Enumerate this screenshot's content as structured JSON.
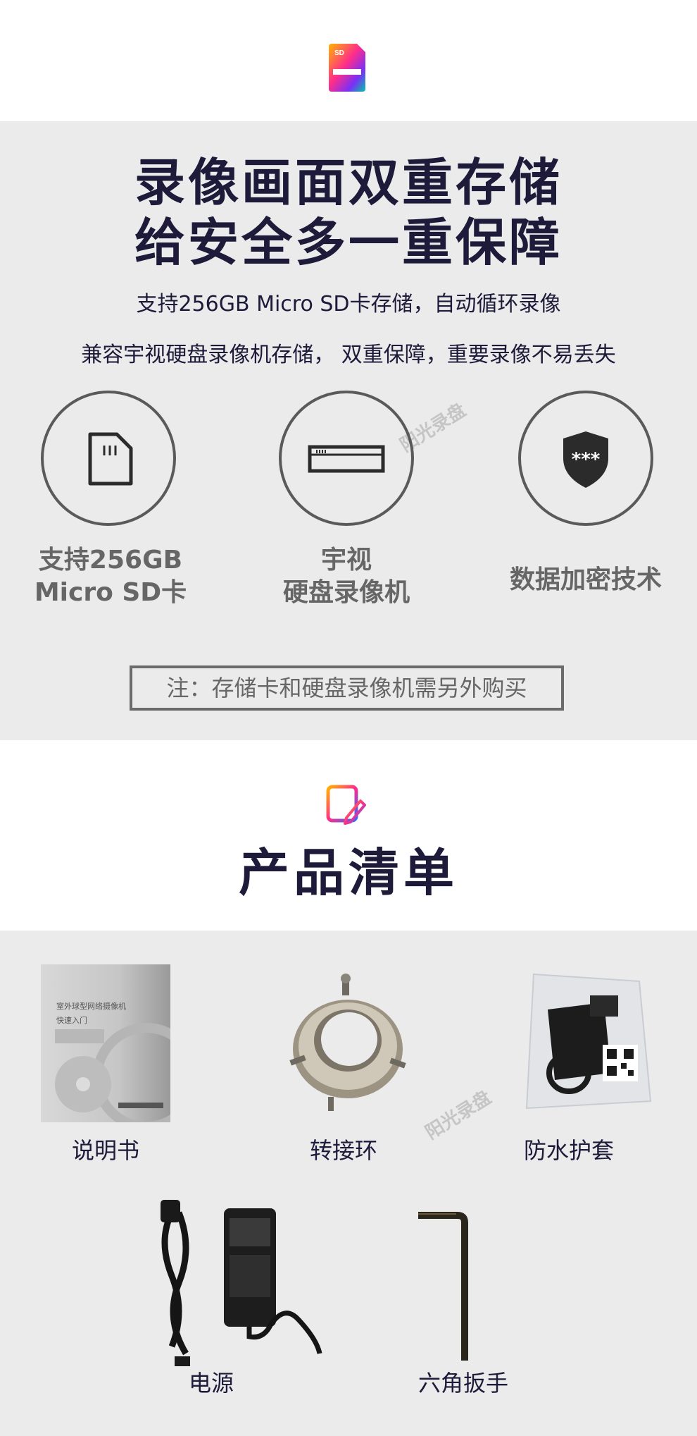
{
  "storage": {
    "title_line1": "录像画面双重存储",
    "title_line2": "给安全多一重保障",
    "subtitle1": "支持256GB Micro SD卡存储，自动循环录像",
    "subtitle2": "兼容宇视硬盘录像机存储， 双重保障，重要录像不易丢失",
    "features": [
      {
        "line1": "支持256GB",
        "line2": "Micro SD卡",
        "icon": "sd-card-icon"
      },
      {
        "line1": "宇视",
        "line2": "硬盘录像机",
        "icon": "nvr-icon"
      },
      {
        "line1": "数据加密技术",
        "icon": "shield-password-icon"
      }
    ],
    "note": "注：存储卡和硬盘录像机需另外购买"
  },
  "watermark": "阳光录盘",
  "manual_cover": {
    "line1": "室外球型网络摄像机",
    "line2": "快速入门"
  },
  "package": {
    "title": "产品清单",
    "items": [
      {
        "label": "说明书"
      },
      {
        "label": "转接环"
      },
      {
        "label": "防水护套"
      },
      {
        "label": "电源"
      },
      {
        "label": "六角扳手"
      }
    ]
  },
  "colors": {
    "title": "#1e1b3a",
    "gray_band": "#ebebeb",
    "feature_gray": "#666666"
  }
}
